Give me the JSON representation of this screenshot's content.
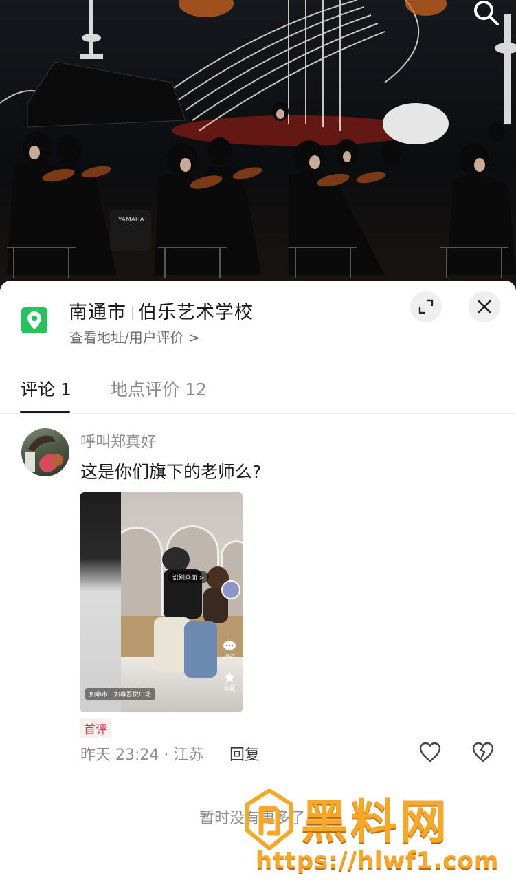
{
  "location": {
    "city": "南通市",
    "name": "伯乐艺术学校",
    "subtitle": "查看地址/用户评价 >"
  },
  "tabs": [
    {
      "label": "评论 1",
      "active": true
    },
    {
      "label": "地点评价 12",
      "active": false
    }
  ],
  "comment": {
    "username": "呼叫郑真好",
    "text": "这是你们旗下的老师么?",
    "badge": "首评",
    "time_location": "昨天 23:24 · 江苏",
    "reply_label": "回复",
    "thumbnail": {
      "recognize_label": "识别画面 >",
      "location_label": "如皋市 | 如皋吾悦广场",
      "comment_label": "评论",
      "favorite_label": "收藏"
    }
  },
  "footer": {
    "no_more_text": "暂时没有更多了"
  },
  "watermark": {
    "text": "黑料网",
    "url": "https://hlwf1.com"
  },
  "colors": {
    "location_icon_green": "#25c25d",
    "badge_red": "#e8384d",
    "watermark_orange": "#f7a82a"
  }
}
